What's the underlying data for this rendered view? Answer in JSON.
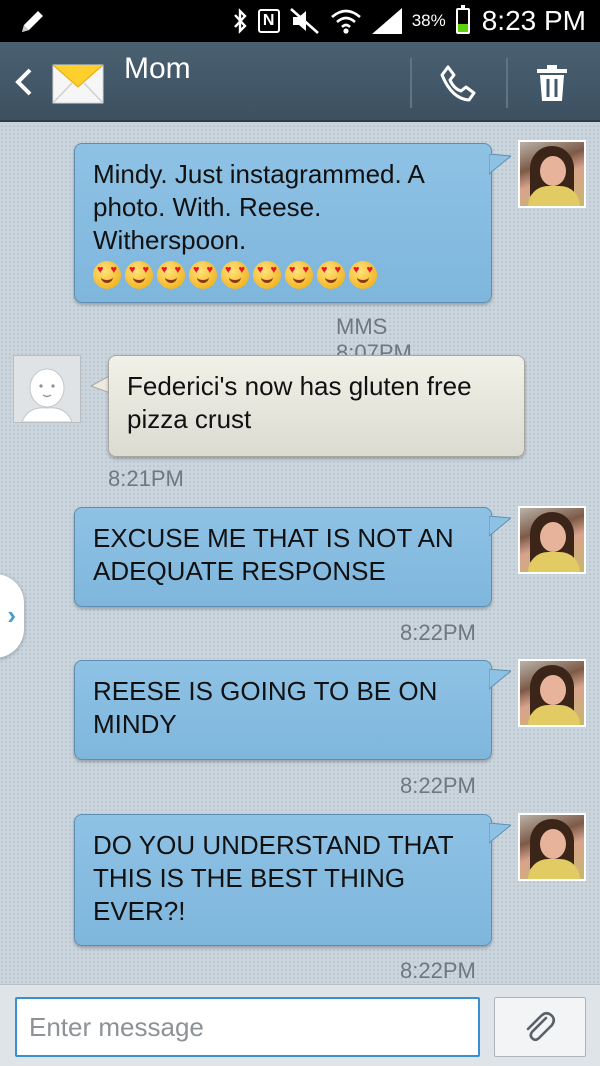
{
  "status_bar": {
    "battery_percent": "38%",
    "battery_level": 0.38,
    "time": "8:23 PM",
    "icons": [
      "pencil-icon",
      "bluetooth-icon",
      "nfc-icon",
      "mute-icon",
      "wifi-icon",
      "signal-icon",
      "battery-icon"
    ]
  },
  "header": {
    "contact_name": "Mom",
    "icons": [
      "back-icon",
      "envelope-icon",
      "phone-icon",
      "trash-icon"
    ]
  },
  "messages": [
    {
      "direction": "outgoing",
      "text": "Mindy. Just instagrammed. A photo. With. Reese. Witherspoon.",
      "emoji_count": 9,
      "emoji_name": "heart-eyes-emoji",
      "timestamp": "MMS 8:07PM"
    },
    {
      "direction": "incoming",
      "text": "Federici's now has gluten free pizza crust",
      "timestamp": "8:21PM"
    },
    {
      "direction": "outgoing",
      "text": "EXCUSE ME THAT IS NOT AN ADEQUATE RESPONSE",
      "timestamp": "8:22PM"
    },
    {
      "direction": "outgoing",
      "text": "REESE IS GOING TO BE ON MINDY",
      "timestamp": "8:22PM"
    },
    {
      "direction": "outgoing",
      "text": "DO YOU UNDERSTAND THAT THIS IS THE BEST THING EVER?!",
      "timestamp": "8:22PM"
    }
  ],
  "compose": {
    "placeholder": "Enter message",
    "value": ""
  },
  "colors": {
    "outgoing_bubble": "#86bde2",
    "incoming_bubble": "#e8e7de",
    "header_bg": "#445a6a",
    "input_border": "#3a8fd0"
  }
}
